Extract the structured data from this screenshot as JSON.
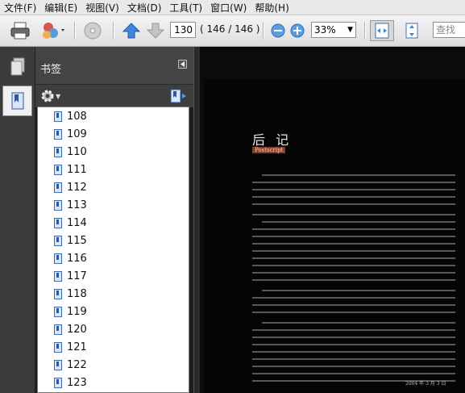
{
  "menu": [
    "文件(F)",
    "编辑(E)",
    "视图(V)",
    "文档(D)",
    "工具(T)",
    "窗口(W)",
    "帮助(H)"
  ],
  "toolbar": {
    "page_current": "130",
    "page_of": "( 146 / 146 )",
    "zoom": "33%",
    "search_placeholder": "查找"
  },
  "bookmarks_panel": {
    "title": "书签",
    "items": [
      "108",
      "109",
      "110",
      "111",
      "112",
      "113",
      "114",
      "115",
      "116",
      "117",
      "118",
      "119",
      "120",
      "121",
      "122",
      "123"
    ]
  },
  "document": {
    "title": "后 记",
    "subtitle": "Postscript",
    "date": "2004 年 3 月 3 日"
  },
  "colors": {
    "accent": "#8b3a2a",
    "panel": "#3b3b3b"
  }
}
